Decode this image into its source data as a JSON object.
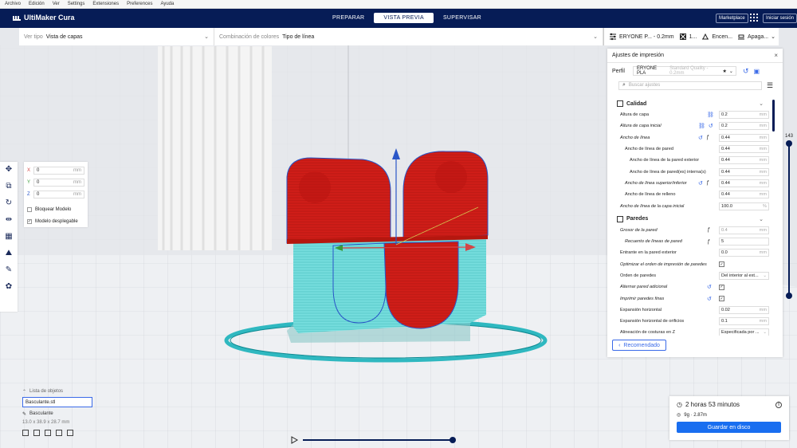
{
  "menubar": {
    "items": [
      "Archivo",
      "Edición",
      "Ver",
      "Settings",
      "Extensiones",
      "Preferences",
      "Ayuda"
    ]
  },
  "header": {
    "app_title": "UltiMaker Cura",
    "stages": [
      "PREPARAR",
      "VISTA PREVIA",
      "SUPERVISAR"
    ],
    "active_stage": "VISTA PREVIA",
    "marketplace_label": "Marketplace",
    "signin_label": "Iniciar sesión"
  },
  "viewbar": {
    "view_type_label": "Ver tipo",
    "view_type_value": "Vista de capas",
    "color_scheme_label": "Combinación de colores",
    "color_scheme_value": "Tipo de línea"
  },
  "printerbar": {
    "printer": "ERYONE P... - 0.2mm",
    "extruders": "1...",
    "support": "Encen...",
    "adhesion": "Apaga..."
  },
  "transform": {
    "x_label": "X",
    "x_value": "0",
    "x_unit": "mm",
    "y_label": "Y",
    "y_value": "0",
    "y_unit": "mm",
    "z_label": "Z",
    "z_value": "0",
    "z_unit": "mm",
    "lock_model_label": "Bloquear Modelo",
    "lock_model_checked": false,
    "drop_model_label": "Modelo desplegable",
    "drop_model_checked": true
  },
  "object_list": {
    "title": "Lista de objetos",
    "file": "Basculante.stl",
    "object_name": "Basculante",
    "dimensions": "13.0 x 38.9 x 28.7 mm"
  },
  "layer_slider": {
    "current_layer": "143",
    "fraction": 1.0
  },
  "timeline": {
    "fraction": 1.0
  },
  "settings_panel": {
    "title": "Ajustes de impresión",
    "profile_label": "Perfil",
    "profile_value": "ERYONE PLA",
    "profile_sub": "Standard Quality - 0.2mm",
    "search_placeholder": "Buscar ajustes",
    "categories": [
      {
        "name": "Calidad",
        "rows": [
          {
            "label": "Altura de capa",
            "italic": false,
            "indent": 0,
            "value": "0.2",
            "unit": "mm",
            "icons": "link"
          },
          {
            "label": "Altura de capa inicial",
            "italic": true,
            "indent": 0,
            "value": "0.2",
            "unit": "mm",
            "icons": "link-reset"
          },
          {
            "label": "Ancho de línea",
            "italic": true,
            "indent": 0,
            "value": "0.44",
            "unit": "mm",
            "icons": "reset-fx"
          },
          {
            "label": "Ancho de línea de pared",
            "italic": false,
            "indent": 1,
            "value": "0.44",
            "unit": "mm",
            "icons": ""
          },
          {
            "label": "Ancho de línea de la pared exterior",
            "italic": false,
            "indent": 2,
            "value": "0.44",
            "unit": "mm",
            "icons": ""
          },
          {
            "label": "Ancho de línea de pared(es) interna(s)",
            "italic": false,
            "indent": 2,
            "value": "0.44",
            "unit": "mm",
            "icons": ""
          },
          {
            "label": "Ancho de línea superior/inferior",
            "italic": true,
            "indent": 1,
            "value": "0.44",
            "unit": "mm",
            "icons": "reset-fx"
          },
          {
            "label": "Ancho de línea de relleno",
            "italic": false,
            "indent": 1,
            "value": "0.44",
            "unit": "mm",
            "icons": ""
          },
          {
            "label": "Ancho de línea de la capa inicial",
            "italic": true,
            "indent": 0,
            "value": "100.0",
            "unit": "%",
            "icons": ""
          }
        ]
      },
      {
        "name": "Paredes",
        "rows": [
          {
            "label": "Grosor de la pared",
            "italic": true,
            "indent": 0,
            "value": "0.4",
            "unit": "mm",
            "icons": "fx",
            "disabled": true
          },
          {
            "label": "Recuento de líneas de pared",
            "italic": true,
            "indent": 1,
            "value": "5",
            "unit": "",
            "icons": "fx"
          },
          {
            "label": "Entrante en la pared exterior",
            "italic": false,
            "indent": 0,
            "value": "0.0",
            "unit": "mm",
            "icons": ""
          },
          {
            "label": "Optimizar el orden de impresión de paredes",
            "italic": true,
            "indent": 0,
            "check": true,
            "icons": ""
          },
          {
            "label": "Orden de paredes",
            "italic": false,
            "indent": 0,
            "value": "Del interior al ext...",
            "unit": "⌄",
            "icons": ""
          },
          {
            "label": "Alternar pared adicional",
            "italic": true,
            "indent": 0,
            "check": true,
            "icons": "reset"
          },
          {
            "label": "Imprimir paredes finas",
            "italic": true,
            "indent": 0,
            "check": true,
            "icons": "reset"
          },
          {
            "label": "Expansión horizontal",
            "italic": false,
            "indent": 0,
            "value": "0.02",
            "unit": "mm",
            "icons": ""
          },
          {
            "label": "Expansión horizontal de orificios",
            "italic": false,
            "indent": 0,
            "value": "0.1",
            "unit": "mm",
            "icons": ""
          },
          {
            "label": "Alineación de costuras en Z",
            "italic": false,
            "indent": 0,
            "value": "Especificada por ...",
            "unit": "⌄",
            "icons": ""
          }
        ]
      }
    ],
    "recommended_label": "Recomendado"
  },
  "estimate": {
    "time": "2 horas 53 minutos",
    "material": "9g · 2.87m",
    "save_label": "Guardar en disco"
  },
  "colors": {
    "header": "#061c56",
    "accent": "#196ef0",
    "model_red": "#d4201c",
    "support_cyan": "#6fd8d8"
  }
}
